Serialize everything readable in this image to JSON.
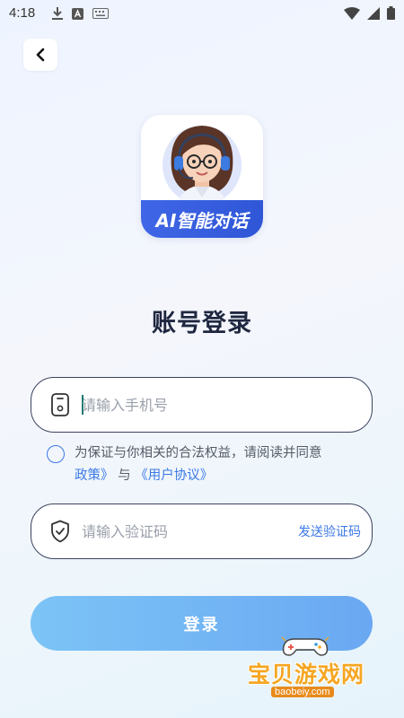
{
  "status_bar": {
    "time": "4:18"
  },
  "app": {
    "logo_text": "AI智能对话"
  },
  "page": {
    "title": "账号登录"
  },
  "phone_field": {
    "placeholder": "请输入手机号"
  },
  "agreement": {
    "prefix": "为保证与你相关的合法权益，请阅读并同意",
    "policy_link": "政策》",
    "conjunction": "与",
    "user_agreement_link": "《用户协议》"
  },
  "code_field": {
    "placeholder": "请输入验证码",
    "send_code_label": "发送验证码"
  },
  "login_button": {
    "label": "登录"
  },
  "watermark": {
    "name": "宝贝游戏网",
    "url": "baobeiy.com"
  },
  "colors": {
    "accent": "#3b78e7",
    "button": "#6aa8f2",
    "title": "#1f2740"
  }
}
